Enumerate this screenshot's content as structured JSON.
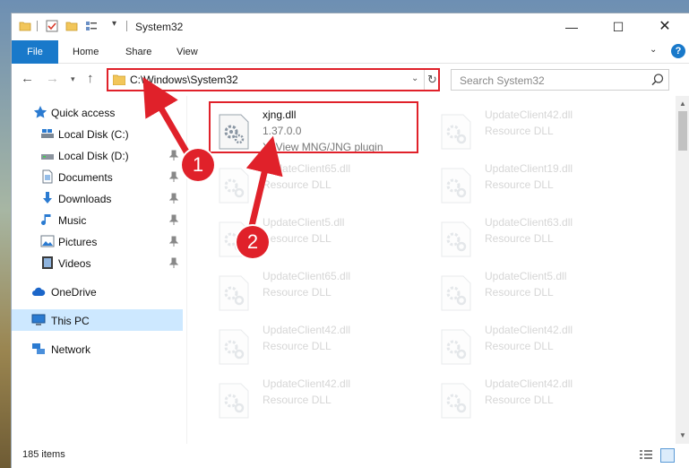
{
  "window": {
    "title": "System32",
    "controls": {
      "minimize": "—",
      "maximize": "☐",
      "close": "✕"
    }
  },
  "ribbon": {
    "tabs": [
      "File",
      "Home",
      "Share",
      "View"
    ],
    "help": "?"
  },
  "nav": {
    "address": "C:\\Windows\\System32",
    "search_placeholder": "Search System32"
  },
  "sidebar": {
    "items": [
      {
        "label": "Quick access",
        "icon": "star-icon",
        "pinned": false
      },
      {
        "label": "Local Disk (C:)",
        "icon": "drive-icon",
        "pinned": false
      },
      {
        "label": "Local Disk (D:)",
        "icon": "drive-icon",
        "pinned": true
      },
      {
        "label": "Documents",
        "icon": "documents-icon",
        "pinned": true
      },
      {
        "label": "Downloads",
        "icon": "download-icon",
        "pinned": true
      },
      {
        "label": "Music",
        "icon": "music-icon",
        "pinned": true
      },
      {
        "label": "Pictures",
        "icon": "pictures-icon",
        "pinned": true
      },
      {
        "label": "Videos",
        "icon": "videos-icon",
        "pinned": true
      },
      {
        "label": "OneDrive",
        "icon": "cloud-icon",
        "pinned": false
      },
      {
        "label": "This PC",
        "icon": "pc-icon",
        "pinned": false,
        "selected": true
      },
      {
        "label": "Network",
        "icon": "network-icon",
        "pinned": false
      }
    ]
  },
  "files": {
    "selected": {
      "name": "xjng.dll",
      "version": "1.37.0.0",
      "description": "XnView MNG/JNG plugin"
    },
    "left_column": [
      {
        "name": "UpdateClient65.dll",
        "type": "Resource DLL"
      },
      {
        "name": "UpdateClient5.dll",
        "type": "Resource DLL"
      },
      {
        "name": "UpdateClient65.dll",
        "type": "Resource DLL"
      },
      {
        "name": "UpdateClient42.dll",
        "type": "Resource DLL"
      },
      {
        "name": "UpdateClient42.dll",
        "type": "Resource DLL"
      }
    ],
    "right_column": [
      {
        "name": "UpdateClient42.dll",
        "type": "Resource DLL"
      },
      {
        "name": "UpdateClient19.dll",
        "type": "Resource DLL"
      },
      {
        "name": "UpdateClient63.dll",
        "type": "Resource DLL"
      },
      {
        "name": "UpdateClient5.dll",
        "type": "Resource DLL"
      },
      {
        "name": "UpdateClient42.dll",
        "type": "Resource DLL"
      },
      {
        "name": "UpdateClient42.dll",
        "type": "Resource DLL"
      }
    ]
  },
  "status": {
    "item_count": "185 items"
  },
  "annotations": {
    "step1": "1",
    "step2": "2"
  },
  "colors": {
    "accent": "#1979ca",
    "annotation": "#e0212a",
    "selection": "#cde8ff"
  }
}
